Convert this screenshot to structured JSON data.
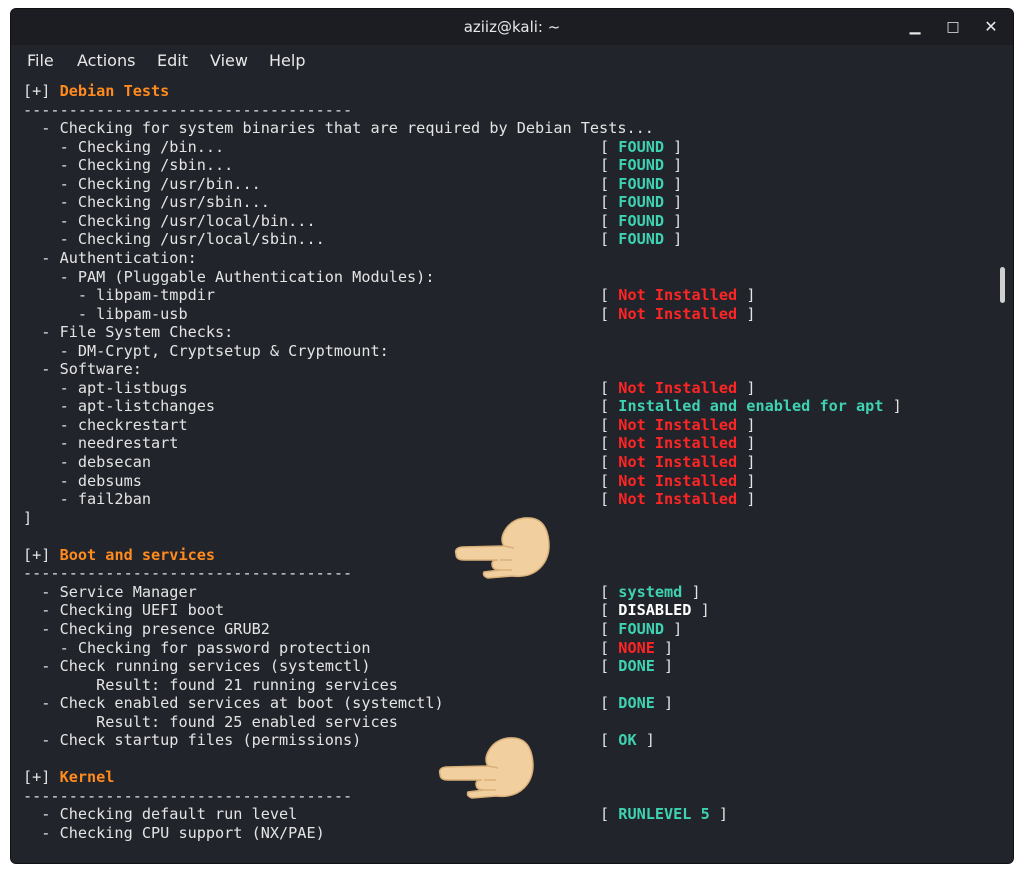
{
  "window": {
    "title": "aziiz@kali: ~",
    "minimize_glyph": "▁",
    "maximize_glyph": "□",
    "close_glyph": "✕"
  },
  "menu": [
    "File",
    "Actions",
    "Edit",
    "View",
    "Help"
  ],
  "colors": {
    "header": "#ff8a1e",
    "ok": "#3fd2b2",
    "bad": "#ff2525",
    "text": "#e4e4e4",
    "bg": "#21242a"
  },
  "lines": [
    {
      "t": "[+] ",
      "h": "Debian Tests"
    },
    {
      "t": "------------------------------------"
    },
    {
      "t": "  - Checking for system binaries that are required by Debian Tests..."
    },
    {
      "t": "    - Checking /bin...",
      "s": "FOUND",
      "c": "green"
    },
    {
      "t": "    - Checking /sbin...",
      "s": "FOUND",
      "c": "green"
    },
    {
      "t": "    - Checking /usr/bin...",
      "s": "FOUND",
      "c": "green"
    },
    {
      "t": "    - Checking /usr/sbin...",
      "s": "FOUND",
      "c": "green"
    },
    {
      "t": "    - Checking /usr/local/bin...",
      "s": "FOUND",
      "c": "green"
    },
    {
      "t": "    - Checking /usr/local/sbin...",
      "s": "FOUND",
      "c": "green"
    },
    {
      "t": "  - Authentication:"
    },
    {
      "t": "    - PAM (Pluggable Authentication Modules):"
    },
    {
      "t": "      - libpam-tmpdir",
      "s": "Not Installed",
      "c": "red"
    },
    {
      "t": "      - libpam-usb",
      "s": "Not Installed",
      "c": "red"
    },
    {
      "t": "  - File System Checks:"
    },
    {
      "t": "    - DM-Crypt, Cryptsetup & Cryptmount:"
    },
    {
      "t": "  - Software:"
    },
    {
      "t": "    - apt-listbugs",
      "s": "Not Installed",
      "c": "red"
    },
    {
      "t": "    - apt-listchanges",
      "s": "Installed and enabled for apt",
      "c": "green"
    },
    {
      "t": "    - checkrestart",
      "s": "Not Installed",
      "c": "red"
    },
    {
      "t": "    - needrestart",
      "s": "Not Installed",
      "c": "red"
    },
    {
      "t": "    - debsecan",
      "s": "Not Installed",
      "c": "red"
    },
    {
      "t": "    - debsums",
      "s": "Not Installed",
      "c": "red"
    },
    {
      "t": "    - fail2ban",
      "s": "Not Installed",
      "c": "red"
    },
    {
      "t": "]"
    },
    {
      "t": ""
    },
    {
      "t": "[+] ",
      "h": "Boot and services"
    },
    {
      "t": "------------------------------------"
    },
    {
      "t": "  - Service Manager",
      "s": "systemd",
      "c": "green"
    },
    {
      "t": "  - Checking UEFI boot",
      "s": "DISABLED",
      "c": "white"
    },
    {
      "t": "  - Checking presence GRUB2",
      "s": "FOUND",
      "c": "green"
    },
    {
      "t": "    - Checking for password protection",
      "s": "NONE",
      "c": "red"
    },
    {
      "t": "  - Check running services (systemctl)",
      "s": "DONE",
      "c": "green"
    },
    {
      "t": "        Result: found 21 running services"
    },
    {
      "t": "  - Check enabled services at boot (systemctl)",
      "s": "DONE",
      "c": "green"
    },
    {
      "t": "        Result: found 25 enabled services"
    },
    {
      "t": "  - Check startup files (permissions)",
      "s": "OK",
      "c": "green"
    },
    {
      "t": ""
    },
    {
      "t": "[+] ",
      "h": "Kernel"
    },
    {
      "t": "------------------------------------"
    },
    {
      "t": "  - Checking default run level",
      "s": "RUNLEVEL 5",
      "c": "green"
    },
    {
      "t": "  - Checking CPU support (NX/PAE)"
    }
  ]
}
